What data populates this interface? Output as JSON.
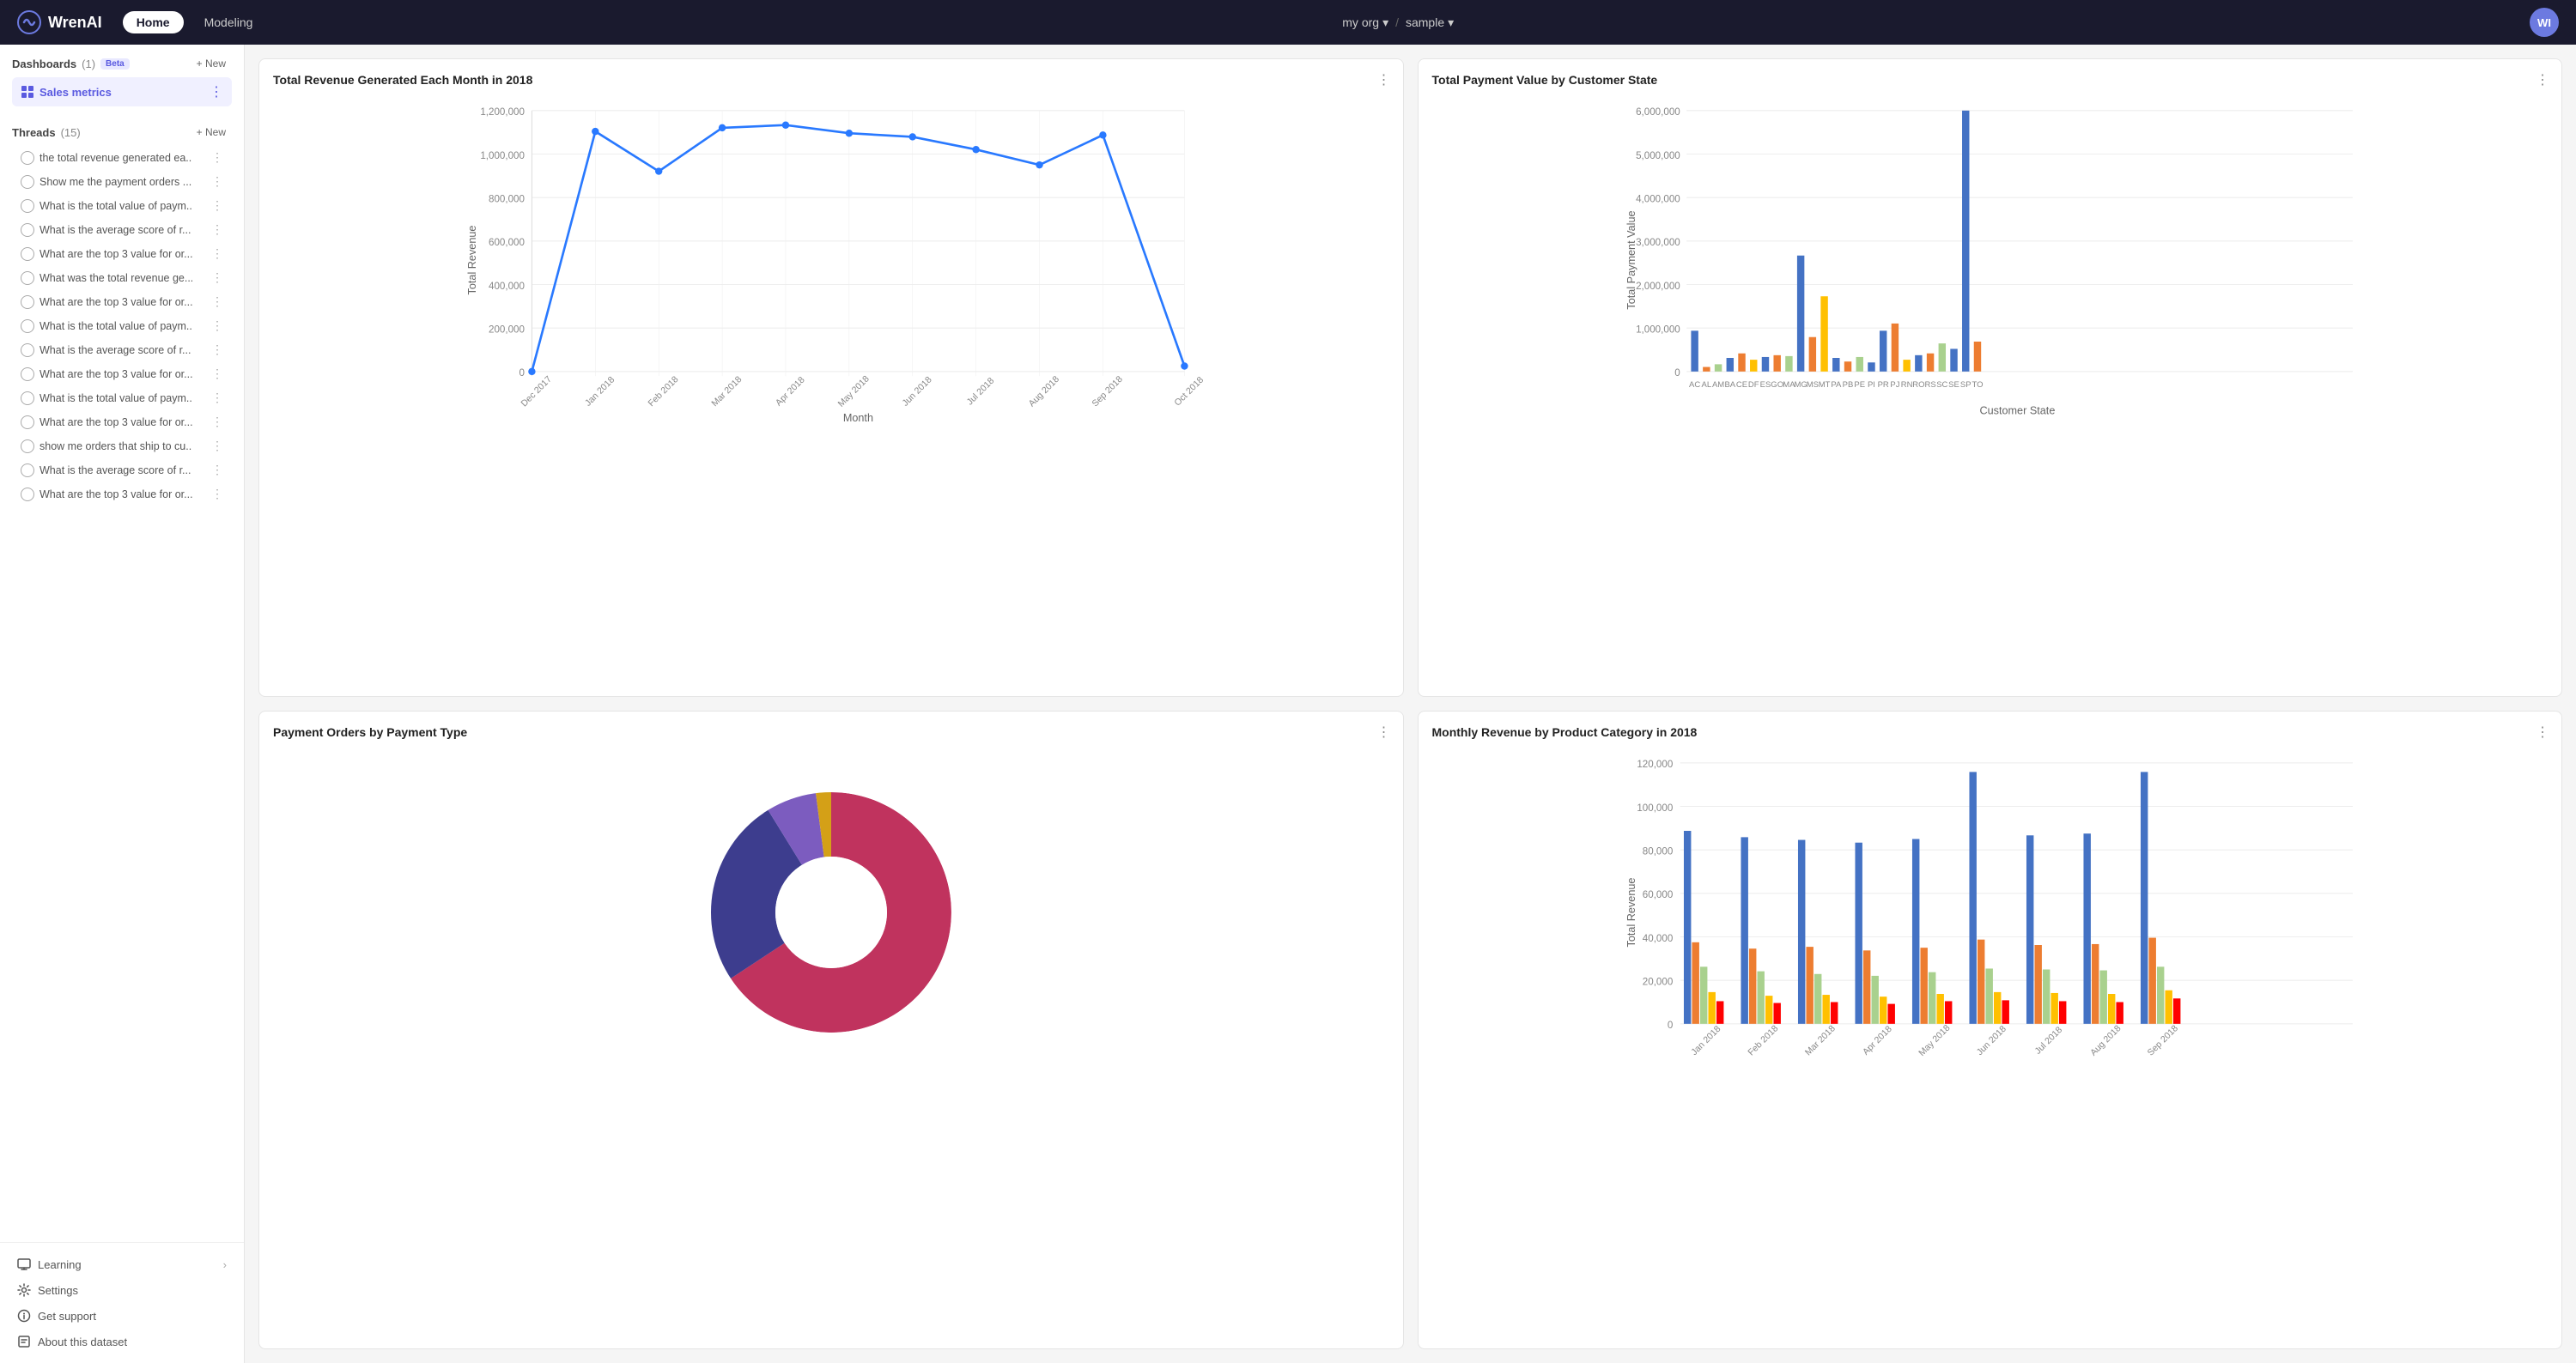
{
  "topnav": {
    "logo_text": "WrenAI",
    "btn_home": "Home",
    "btn_modeling": "Modeling",
    "org_label": "my org",
    "sample_label": "sample",
    "avatar_initials": "WI"
  },
  "sidebar": {
    "dashboards_label": "Dashboards",
    "dashboards_count": "(1)",
    "dashboards_beta": "Beta",
    "new_label": "+ New",
    "sales_metrics_label": "Sales metrics",
    "threads_label": "Threads",
    "threads_count": "(15)",
    "thread_items": [
      "the total revenue generated ea...",
      "Show me the payment orders ...",
      "What is the total value of paym...",
      "What is the average score of r...",
      "What are the top 3 value for or...",
      "What was the total revenue ge...",
      "What are the top 3 value for or...",
      "What is the total value of paym...",
      "What is the average score of r...",
      "What are the top 3 value for or...",
      "What is the total value of paym...",
      "What are the top 3 value for or...",
      "show me orders that ship to cu...",
      "What is the average score of r...",
      "What are the top 3 value for or..."
    ],
    "learning_label": "Learning",
    "settings_label": "Settings",
    "get_support_label": "Get support",
    "about_dataset_label": "About this dataset"
  },
  "charts": {
    "revenue_title": "Total Revenue Generated Each Month in 2018",
    "payment_value_title": "Total Payment Value by Customer State",
    "payment_orders_title": "Payment Orders by Payment Type",
    "monthly_revenue_title": "Monthly Revenue by Product Category in 2018"
  }
}
